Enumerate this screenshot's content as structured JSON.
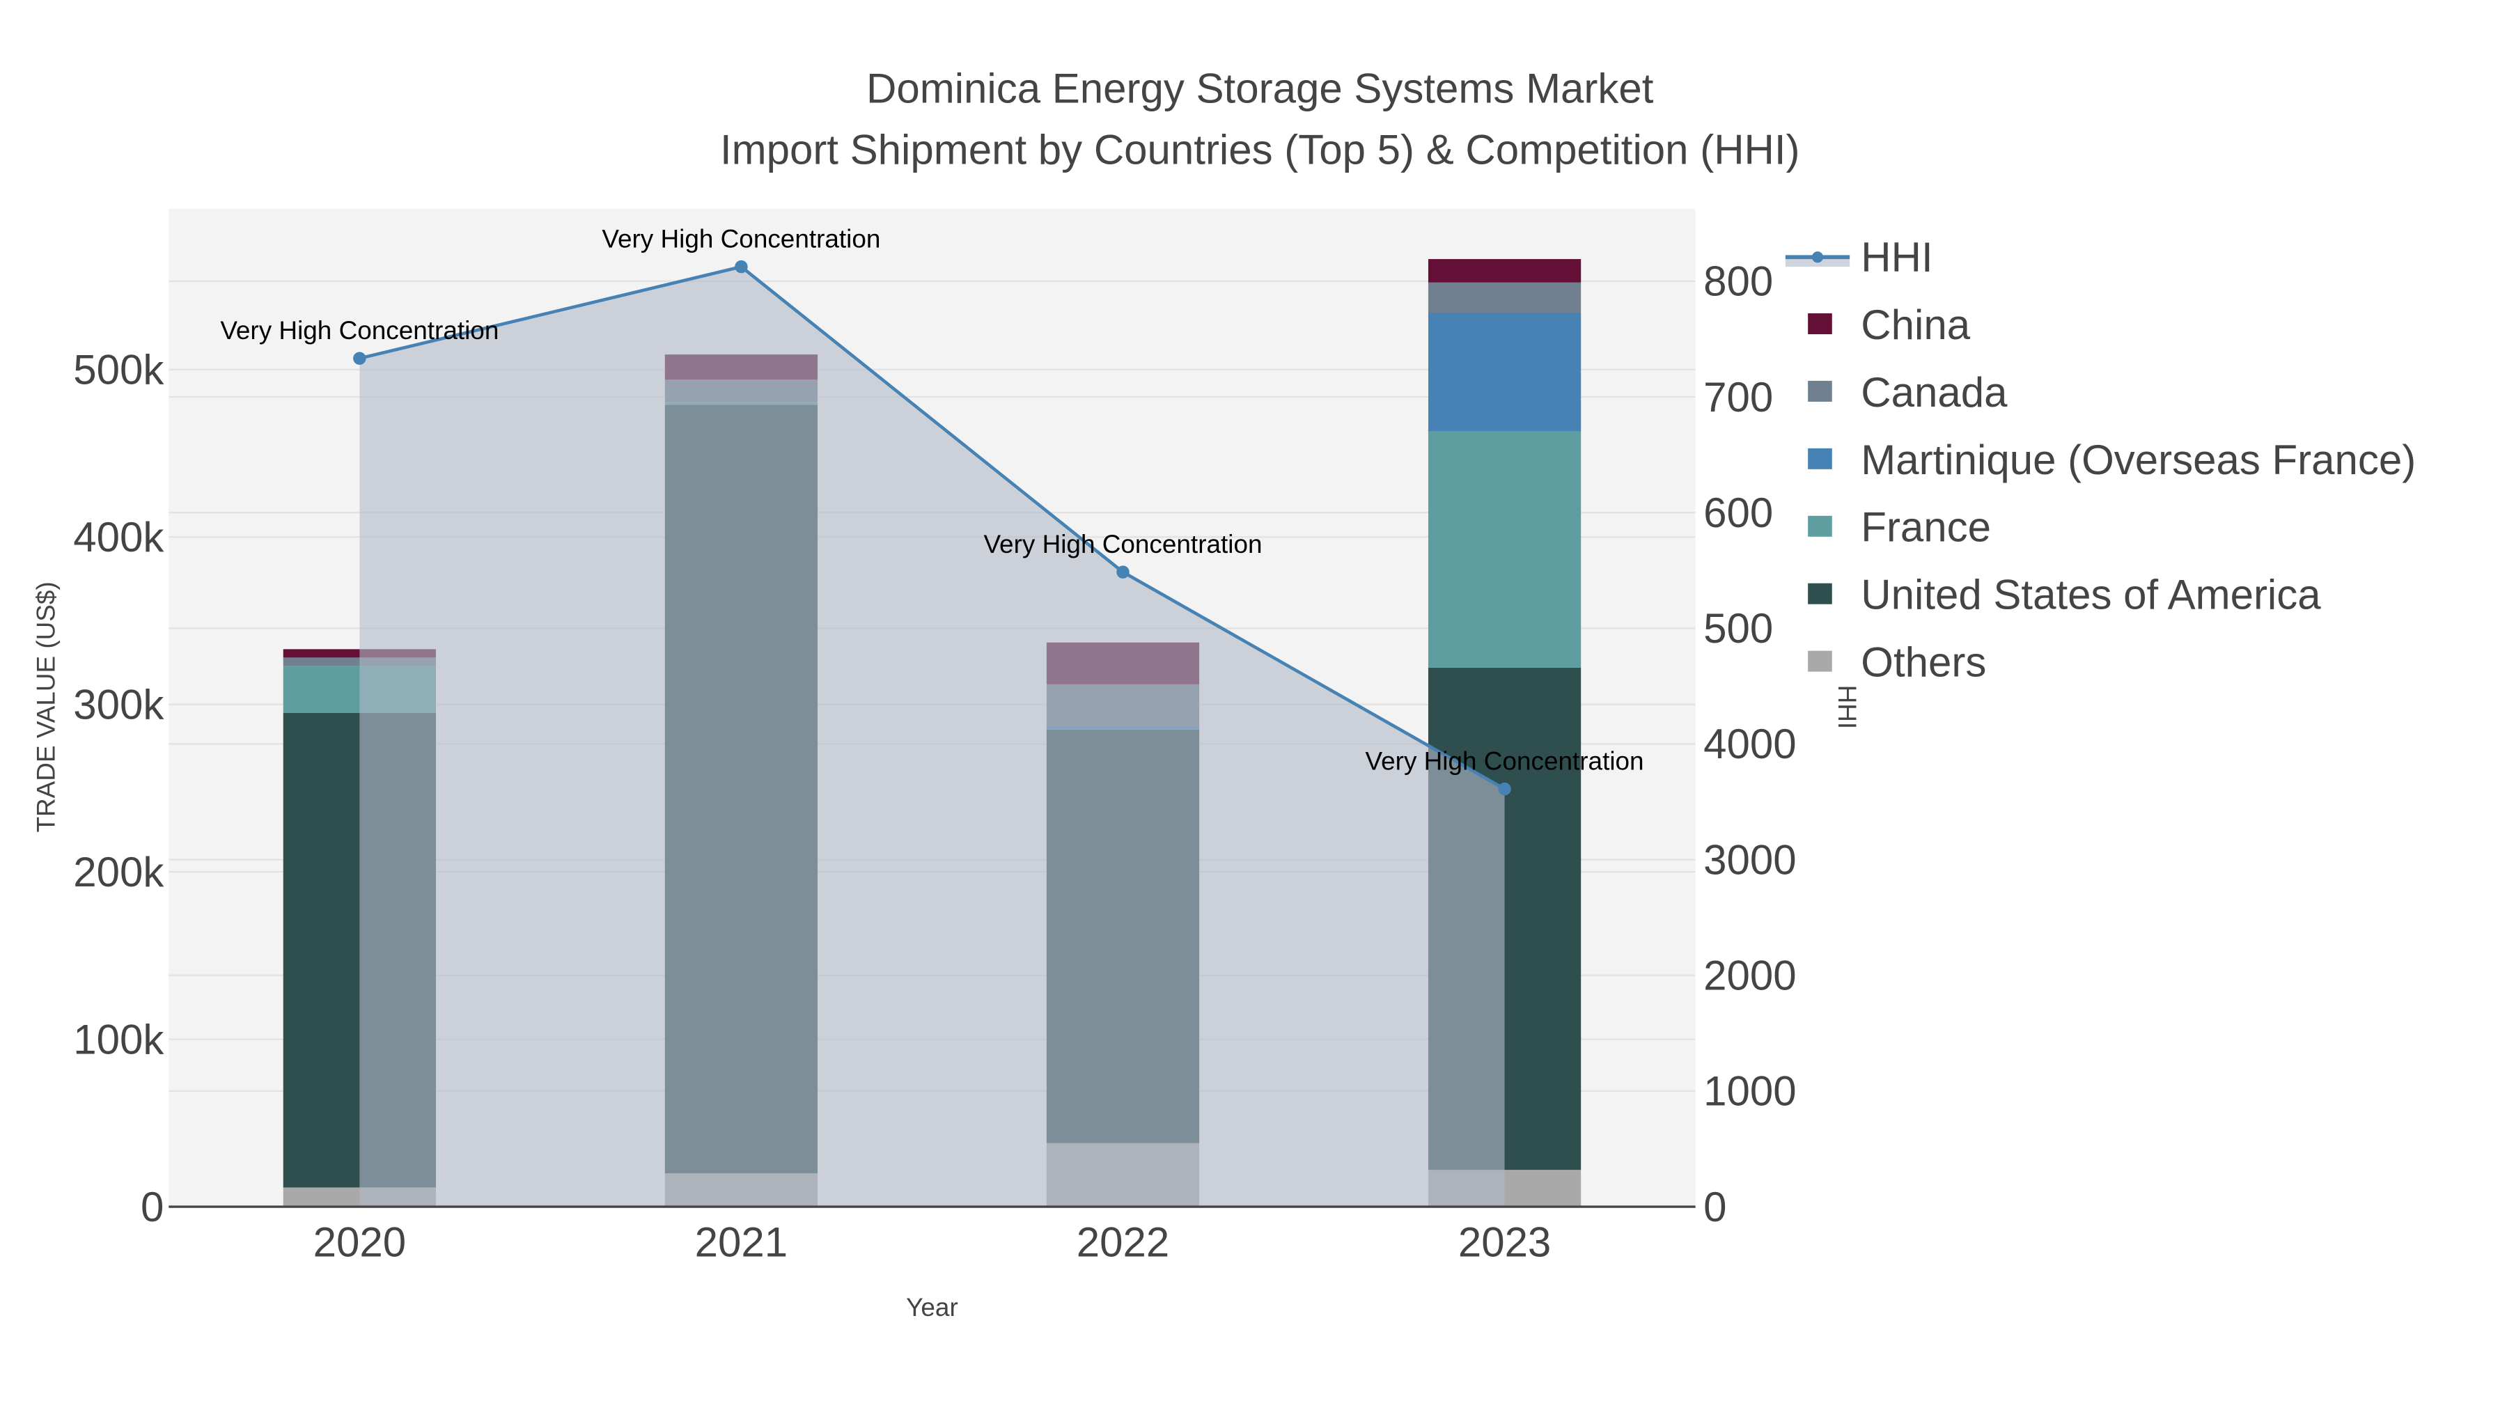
{
  "chart_data": {
    "type": "bar",
    "title": "Dominica Energy Storage Systems Market",
    "subtitle": "Import Shipment by Countries (Top 5) & Competition (HHI)",
    "xlabel": "Year",
    "ylabel": "TRADE VALUE (US$)",
    "y2label": "HHI",
    "categories": [
      "2020",
      "2021",
      "2022",
      "2023"
    ],
    "ylim": [
      0,
      580000
    ],
    "y2lim": [
      0,
      8000
    ],
    "yticks": [
      0,
      100000,
      200000,
      300000,
      400000,
      500000
    ],
    "ytick_labels": [
      "0",
      "100k",
      "200k",
      "300k",
      "400k",
      "500k"
    ],
    "y2ticks": [
      0,
      1000,
      2000,
      3000,
      4000,
      5000,
      6000,
      7000,
      8000
    ],
    "y2tick_labels": [
      "0",
      "1000",
      "2000",
      "3000",
      "4000",
      "500",
      "600",
      "700",
      "800"
    ],
    "series": [
      {
        "name": "Others",
        "color": "#a9a9a9",
        "values": [
          11500,
          20000,
          38000,
          22000
        ]
      },
      {
        "name": "United States of America",
        "color": "#2f4f4f",
        "values": [
          283500,
          459000,
          247000,
          300000
        ]
      },
      {
        "name": "France",
        "color": "#5f9ea0",
        "values": [
          28000,
          1500,
          0,
          141000
        ]
      },
      {
        "name": "Martinique (Overseas France)",
        "color": "#4682b4",
        "values": [
          0,
          0,
          2000,
          71000
        ]
      },
      {
        "name": "Canada",
        "color": "#708090",
        "values": [
          5000,
          13500,
          25000,
          18000
        ]
      },
      {
        "name": "China",
        "color": "#630f36",
        "values": [
          5000,
          15000,
          25000,
          14000
        ]
      }
    ],
    "line": {
      "name": "HHI",
      "color": "#4682b4",
      "values": [
        7333,
        8125,
        5486,
        3611
      ],
      "annotations": [
        "Very High Concentration",
        "Very High Concentration",
        "Very High Concentration",
        "Very High Concentration"
      ]
    },
    "legend_order": [
      "HHI",
      "China",
      "Canada",
      "Martinique (Overseas France)",
      "France",
      "United States of America",
      "Others"
    ],
    "legend_position": "top-right",
    "grid": true
  }
}
